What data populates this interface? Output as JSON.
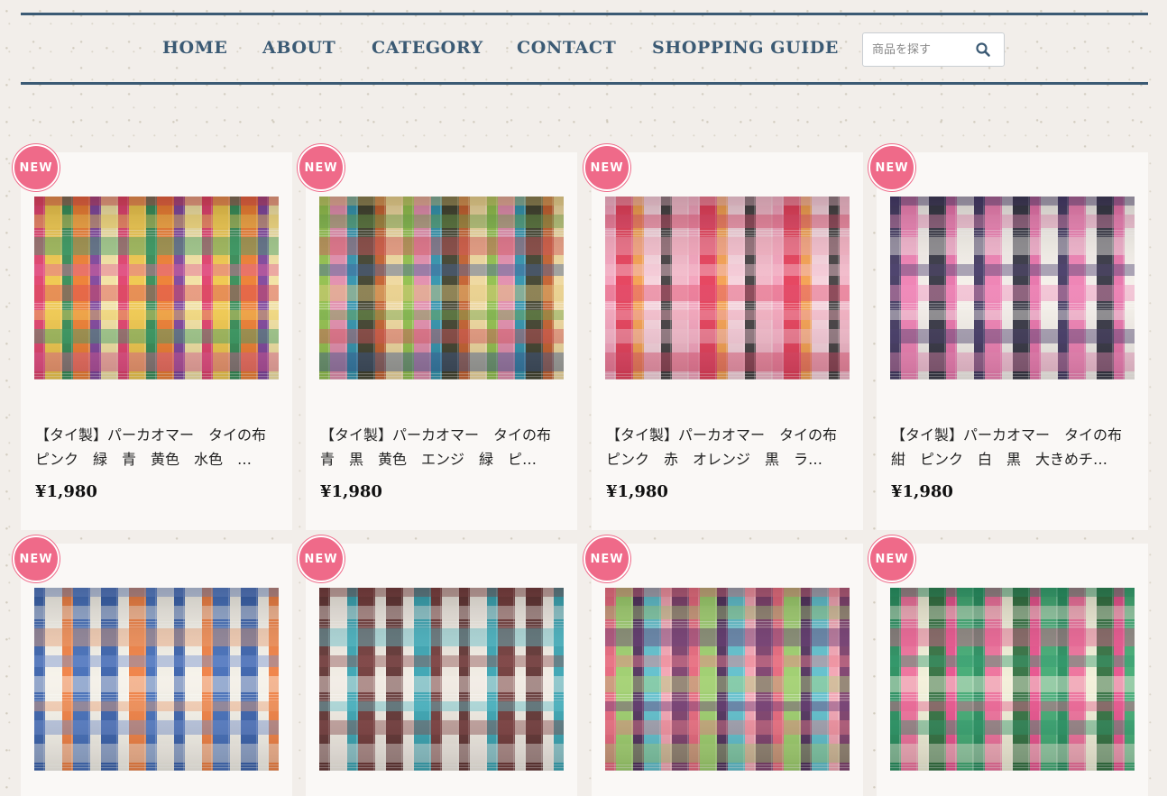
{
  "nav": {
    "items": [
      "HOME",
      "ABOUT",
      "CATEGORY",
      "CONTACT",
      "SHOPPING GUIDE"
    ]
  },
  "search": {
    "placeholder": "商品を探す",
    "icon": "search-icon"
  },
  "badge_label": "NEW",
  "colors": {
    "nav": "#3b5a74",
    "badge": "#ef6a89"
  },
  "products": [
    {
      "title_line1": "【タイ製】パーカオマー　タイの布",
      "title_line2": "ピンク　緑　青　黄色　水色　…",
      "price": "¥1,980",
      "fabric": {
        "base": "#c9a23a",
        "warp": [
          "#e33b6f",
          "#f2c94c",
          "#2e8b57",
          "#f07b2f",
          "#7b3fa0",
          "#f5e6a8"
        ],
        "weft": [
          "#d9414f",
          "#f7d154",
          "#3aa36b",
          "#e65a9a"
        ]
      }
    },
    {
      "title_line1": "【タイ製】パーカオマー　タイの布",
      "title_line2": "青　黒　黄色　エンジ　緑　ピ…",
      "price": "¥1,980",
      "fabric": {
        "base": "#a7b85c",
        "warp": [
          "#8fbf4a",
          "#e58ab0",
          "#2a8fb0",
          "#3a3a2a",
          "#c45a2a",
          "#f2d9a0"
        ],
        "weft": [
          "#e2c878",
          "#6fa84a",
          "#d94f5a",
          "#3c5c9a"
        ]
      }
    },
    {
      "title_line1": "【タイ製】パーカオマー　タイの布",
      "title_line2": "ピンク　赤　オレンジ　黒　ラ…",
      "price": "¥1,980",
      "fabric": {
        "base": "#e98aa6",
        "warp": [
          "#f4a3bd",
          "#e63a54",
          "#f6a04a",
          "#f7d6de",
          "#3a3a3a",
          "#f2b8c8"
        ],
        "weft": [
          "#f6c2d0",
          "#e04a6a",
          "#f3a8bb"
        ]
      }
    },
    {
      "title_line1": "【タイ製】パーカオマー　タイの布",
      "title_line2": "紺　ピンク　白　黒　大きめチ…",
      "price": "¥1,980",
      "fabric": {
        "base": "#e9dfe3",
        "warp": [
          "#3a2f5a",
          "#ef7ab0",
          "#f2ece8",
          "#2b2b3a",
          "#e86ca6",
          "#f5f0ea"
        ],
        "weft": [
          "#4a3c6e",
          "#f08cbb",
          "#f7f1ea"
        ]
      }
    },
    {
      "title_line1": "",
      "title_line2": "",
      "price": "",
      "fabric": {
        "base": "#e9e4dc",
        "warp": [
          "#2f5aa8",
          "#f7f3ea",
          "#f07a3a",
          "#3a66b5",
          "#f2efe6"
        ],
        "weft": [
          "#6f8fd0",
          "#f6f2ea",
          "#f0a070"
        ]
      }
    },
    {
      "title_line1": "",
      "title_line2": "",
      "price": "",
      "fabric": {
        "base": "#e6e0d8",
        "warp": [
          "#5a2a2a",
          "#f1ece4",
          "#2fa0b0",
          "#6a3030",
          "#ede7de"
        ],
        "weft": [
          "#8a4a4a",
          "#f3eee6",
          "#5cc0cc"
        ]
      }
    },
    {
      "title_line1": "",
      "title_line2": "",
      "price": "",
      "fabric": {
        "base": "#c7b08a",
        "warp": [
          "#e8627a",
          "#9bd06a",
          "#4a2a5a",
          "#5ac0d0",
          "#f5a3b5",
          "#7a3a6a"
        ],
        "weft": [
          "#f07a8a",
          "#aad47a",
          "#6a3a7a"
        ]
      }
    },
    {
      "title_line1": "",
      "title_line2": "",
      "price": "",
      "fabric": {
        "base": "#bfd7b0",
        "warp": [
          "#1f8a5a",
          "#f06a9a",
          "#f2f0d8",
          "#2a6a3a",
          "#e94a8a",
          "#3aa870"
        ],
        "weft": [
          "#2a9a6a",
          "#f6f2de",
          "#e8588f"
        ]
      }
    }
  ]
}
